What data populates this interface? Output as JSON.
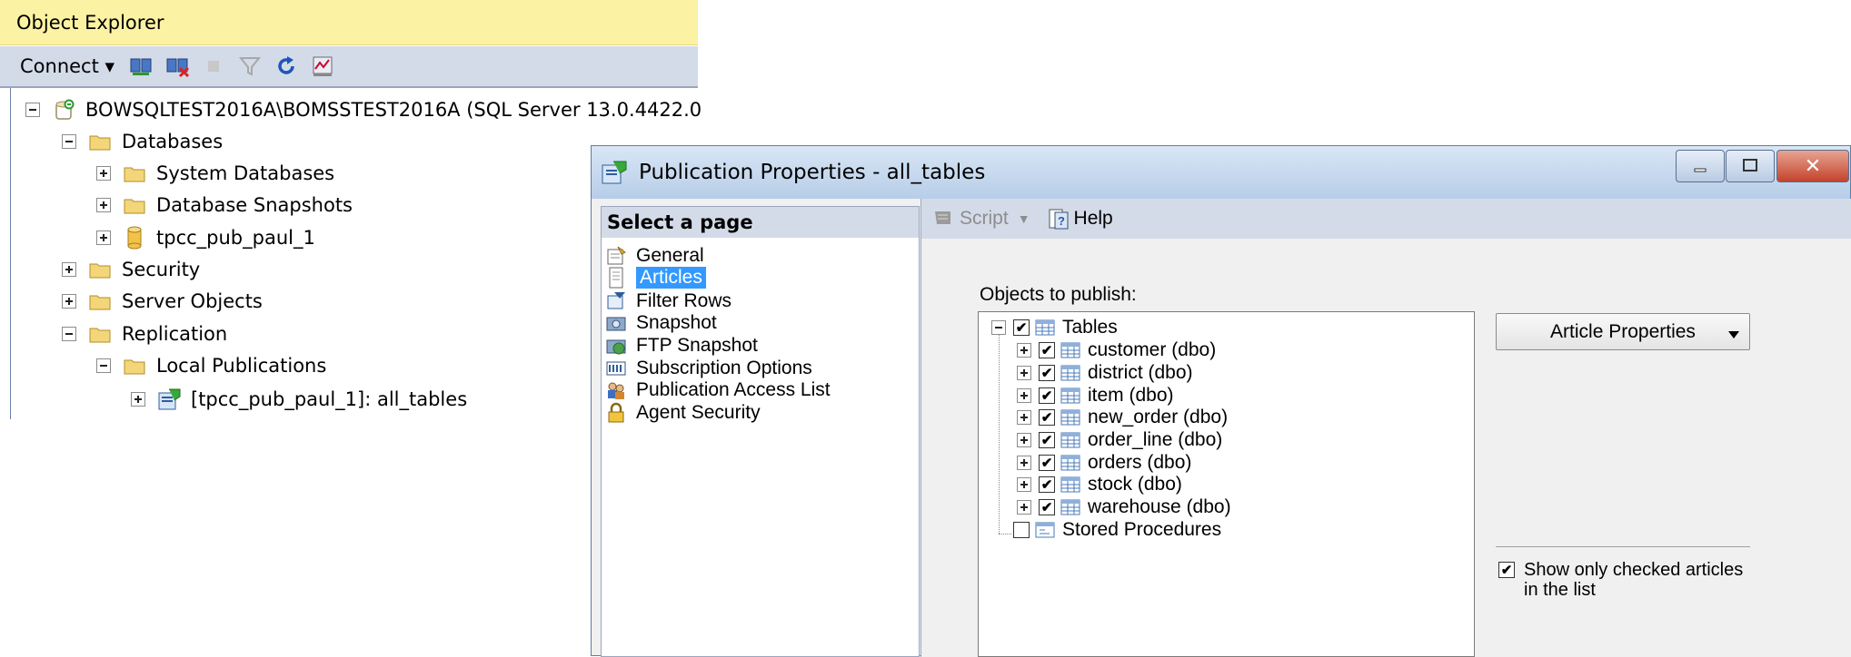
{
  "object_explorer": {
    "title": "Object Explorer",
    "toolbar": {
      "connect_label": "Connect"
    },
    "tree": [
      {
        "label": "BOWSQLTEST2016A\\BOMSSTEST2016A (SQL Server 13.0.4422.0",
        "icon": "server-icon",
        "expander": "minus"
      },
      {
        "label": "Databases",
        "icon": "folder-icon",
        "expander": "minus"
      },
      {
        "label": "System Databases",
        "icon": "folder-icon",
        "expander": "plus"
      },
      {
        "label": "Database Snapshots",
        "icon": "folder-icon",
        "expander": "plus"
      },
      {
        "label": "tpcc_pub_paul_1",
        "icon": "database-icon",
        "expander": "plus"
      },
      {
        "label": "Security",
        "icon": "folder-icon",
        "expander": "plus"
      },
      {
        "label": "Server Objects",
        "icon": "folder-icon",
        "expander": "plus"
      },
      {
        "label": "Replication",
        "icon": "folder-icon",
        "expander": "minus"
      },
      {
        "label": "Local Publications",
        "icon": "folder-icon",
        "expander": "minus"
      },
      {
        "label": "[tpcc_pub_paul_1]: all_tables",
        "icon": "publication-icon",
        "expander": "plus"
      }
    ]
  },
  "dialog": {
    "title": "Publication Properties - all_tables",
    "select_page_header": "Select a page",
    "pages": [
      {
        "label": "General",
        "icon": "general-icon"
      },
      {
        "label": "Articles",
        "icon": "articles-icon",
        "selected": true
      },
      {
        "label": "Filter Rows",
        "icon": "filter-icon"
      },
      {
        "label": "Snapshot",
        "icon": "snapshot-icon"
      },
      {
        "label": "FTP Snapshot",
        "icon": "ftp-icon"
      },
      {
        "label": "Subscription Options",
        "icon": "options-icon"
      },
      {
        "label": "Publication Access List",
        "icon": "users-icon"
      },
      {
        "label": "Agent Security",
        "icon": "lock-icon"
      }
    ],
    "toolbar": {
      "script_label": "Script",
      "help_label": "Help"
    },
    "objects_label": "Objects to publish:",
    "objects_tree": {
      "root": {
        "label": "Tables",
        "checked": true
      },
      "tables": [
        {
          "label": "customer (dbo)",
          "checked": true
        },
        {
          "label": "district (dbo)",
          "checked": true
        },
        {
          "label": "item (dbo)",
          "checked": true
        },
        {
          "label": "new_order (dbo)",
          "checked": true
        },
        {
          "label": "order_line (dbo)",
          "checked": true
        },
        {
          "label": "orders (dbo)",
          "checked": true
        },
        {
          "label": "stock (dbo)",
          "checked": true
        },
        {
          "label": "warehouse (dbo)",
          "checked": true
        }
      ],
      "procedures": {
        "label": "Stored Procedures",
        "checked": false
      }
    },
    "article_properties_label": "Article Properties",
    "show_only_checked_label": "Show only checked articles in the list",
    "show_only_checked": true
  }
}
